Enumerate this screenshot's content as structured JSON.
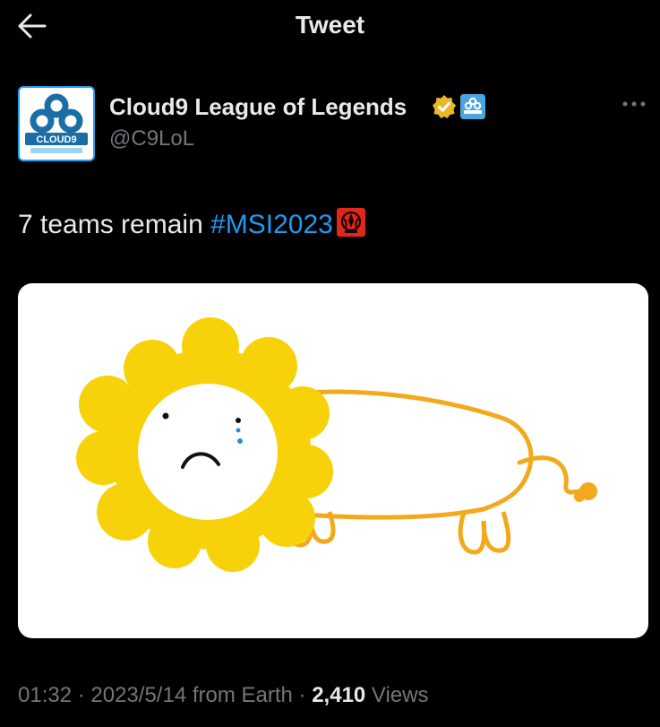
{
  "header": {
    "title": "Tweet",
    "back_icon": "arrow-left-icon"
  },
  "author": {
    "name": "Cloud9 League of Legends",
    "handle": "@C9LoL",
    "avatar_text": "CLOUD9",
    "verified_color": "#e8b829",
    "affiliate_icon": "cloud9-badge-icon"
  },
  "tweet": {
    "text": "7 teams remain ",
    "hashtag": "#MSI2023",
    "emoji_icon": "msi-logo-icon"
  },
  "media": {
    "description_icon": "sad-lion-drawing"
  },
  "meta": {
    "time": "01:32",
    "sep1": " · ",
    "date": "2023/5/14",
    "source": " from Earth",
    "sep2": " · ",
    "views_count": "2,410",
    "views_label": " Views"
  },
  "colors": {
    "accent": "#1d9bf0",
    "background": "#000000",
    "muted": "#71767b"
  }
}
